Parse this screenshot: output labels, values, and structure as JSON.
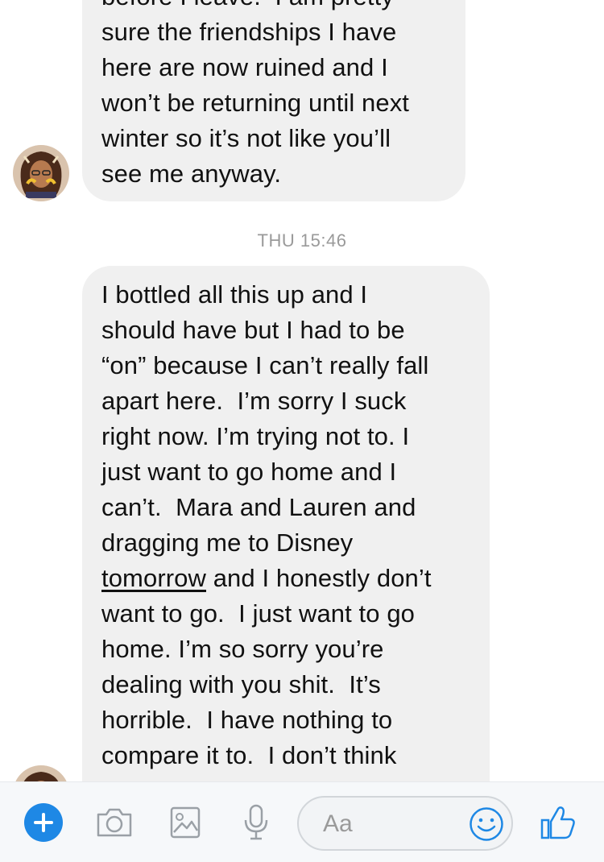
{
  "messages": [
    {
      "lines": [
        "before I leave.  I am pretty",
        "sure the friendships I have",
        "here are now ruined and I",
        "won’t be returning until next",
        "winter so it’s not like you’ll",
        "see me anyway."
      ]
    },
    {
      "timestamp": "THU 15:46",
      "lines": [
        "I bottled all this up and I",
        "should have but I had to be",
        "“on” because I can’t really fall",
        "apart here.  I’m sorry I suck",
        "right now. I’m trying not to. I",
        "just want to go home and I",
        "can’t.  Mara and Lauren and",
        "dragging me to Disney"
      ],
      "link_word": "tomorrow",
      "link_line_rest": " and I honestly don’t",
      "lines_after": [
        "want to go.  I just want to go",
        "home. I’m so sorry you’re",
        "dealing with you shit.  It’s",
        "horrible.  I have nothing to",
        "compare it to.  I don’t think"
      ]
    }
  ],
  "composer": {
    "placeholder": "Aa",
    "icons": [
      "plus-icon",
      "camera-icon",
      "image-icon",
      "microphone-icon",
      "emoji-icon",
      "thumbs-up-icon"
    ],
    "accent_color": "#1e88e5"
  }
}
